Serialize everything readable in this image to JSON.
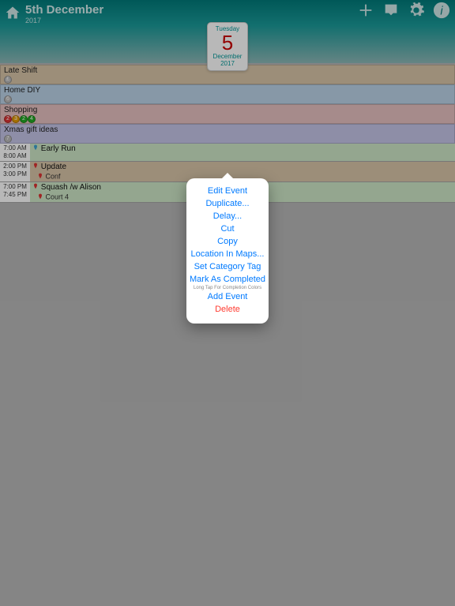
{
  "header": {
    "title": "5th December",
    "year": "2017",
    "chip": {
      "dow": "Tuesday",
      "day": "5",
      "month": "December",
      "year": "2017"
    }
  },
  "allday": [
    {
      "label": "Late Shift",
      "bg": "bg-tan",
      "tags": [
        {
          "bg": "#bbb",
          "txt": "£"
        }
      ]
    },
    {
      "label": "Home DIY",
      "bg": "bg-blue",
      "tags": [
        {
          "bg": "#bbb",
          "txt": "6"
        }
      ]
    },
    {
      "label": "Shopping",
      "bg": "bg-pink",
      "tags": [
        {
          "bg": "#d33",
          "txt": "2"
        },
        {
          "bg": "#e69b00",
          "txt": "3"
        },
        {
          "bg": "#2a2",
          "txt": "2"
        },
        {
          "bg": "#2a2",
          "txt": "4"
        }
      ]
    },
    {
      "label": "Xmas gift ideas",
      "bg": "bg-lilac",
      "tags": [
        {
          "bg": "#bbb",
          "txt": "7"
        }
      ]
    }
  ],
  "timed": [
    {
      "start": "7:00 AM",
      "end": "8:00 AM",
      "title": "Early Run",
      "pin": "#3da3d1",
      "loc": "",
      "bg": "bg-green"
    },
    {
      "start": "2:00 PM",
      "end": "3:00 PM",
      "title": "Update",
      "pin": "#d33",
      "loc": "Conf",
      "bg": "bg-tan2"
    },
    {
      "start": "7:00 PM",
      "end": "7:45 PM",
      "title": "Squash /w Alison",
      "pin": "#d33",
      "loc": "Court 4",
      "bg": "bg-green2"
    }
  ],
  "menu": {
    "items": [
      {
        "label": "Edit Event"
      },
      {
        "label": "Duplicate..."
      },
      {
        "label": "Delay..."
      },
      {
        "label": "Cut"
      },
      {
        "label": "Copy"
      },
      {
        "label": "Location In Maps..."
      },
      {
        "label": "Set Category Tag"
      },
      {
        "label": "Mark As Completed"
      }
    ],
    "hint": "Long Tap For Completion Colors",
    "add": "Add Event",
    "delete": "Delete"
  }
}
